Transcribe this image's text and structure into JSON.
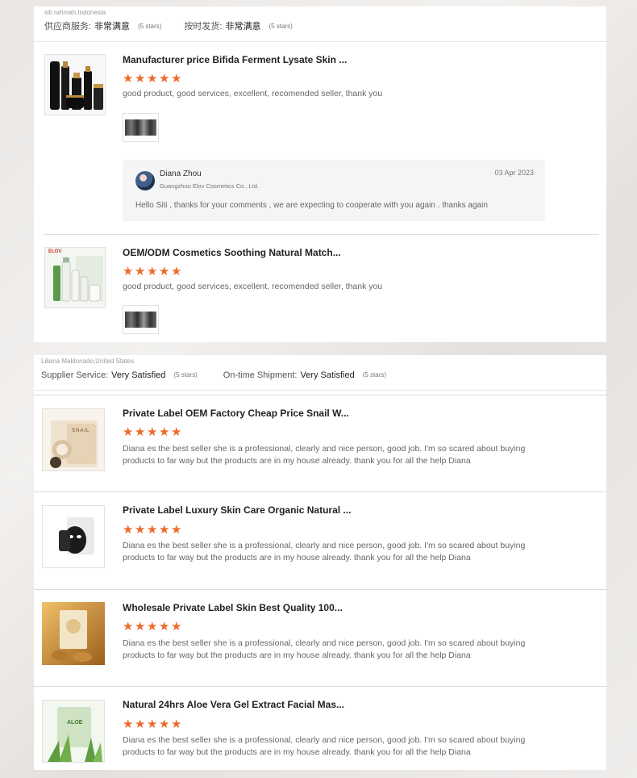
{
  "card1": {
    "reviewer": "siti rahmah,Indonesia",
    "supplier_label": "供应商服务:",
    "supplier_value": "非常满意",
    "supplier_stars": "(5 stars)",
    "shipment_label": "按时发货:",
    "shipment_value": "非常满意",
    "shipment_stars": "(5 stars)",
    "items": [
      {
        "title": "Manufacturer price Bifida Ferment Lysate Skin ...",
        "rating": 5,
        "comment": "good product, good services, excellent, recomended seller, thank you",
        "thumb_icon": "black-gold-skincare-set-icon"
      },
      {
        "title": "OEM/ODM Cosmetics Soothing Natural Match...",
        "rating": 5,
        "comment": "good product, good services, excellent, recomended seller, thank you",
        "thumb_icon": "green-white-skincare-set-icon",
        "thumb_brand": "ELOV"
      }
    ],
    "reply": {
      "name": "Diana Zhou",
      "company": "Guangzhou Elov Cosmetics Co., Ltd.",
      "date": "03 Apr 2023",
      "text": "Hello Siti , thanks for your comments , we are expecting to cooperate with you again . thanks again"
    }
  },
  "card2": {
    "reviewer": "Liliana Maldonado,United States",
    "supplier_label": "Supplier Service:",
    "supplier_value": "Very Satisfied",
    "supplier_stars": "(5 stars)",
    "shipment_label": "On-time Shipment:",
    "shipment_value": "Very Satisfied",
    "shipment_stars": "(5 stars)",
    "comment": "Diana es the best seller she is a professional, clearly and nice person, good job. I'm so scared about buying products to far way but the products are in my house already. thank you for all the help Diana",
    "items": [
      {
        "title": "Private Label OEM Factory Cheap Price Snail W...",
        "rating": 5,
        "thumb_icon": "snail-mask-icon",
        "thumb_text": "SNAIL"
      },
      {
        "title": "Private Label Luxury Skin Care Organic Natural ...",
        "rating": 5,
        "thumb_icon": "black-sheet-mask-icon"
      },
      {
        "title": "Wholesale Private Label Skin Best Quality 100...",
        "rating": 5,
        "thumb_icon": "gold-mask-icon"
      },
      {
        "title": "Natural 24hrs Aloe Vera Gel Extract Facial Mas...",
        "rating": 5,
        "thumb_icon": "aloe-vera-mask-icon",
        "thumb_text": "ALOE"
      }
    ]
  },
  "colors": {
    "star": "#ee6a2b",
    "card_bg": "#ffffff",
    "reply_bg": "#f4f5f7"
  }
}
